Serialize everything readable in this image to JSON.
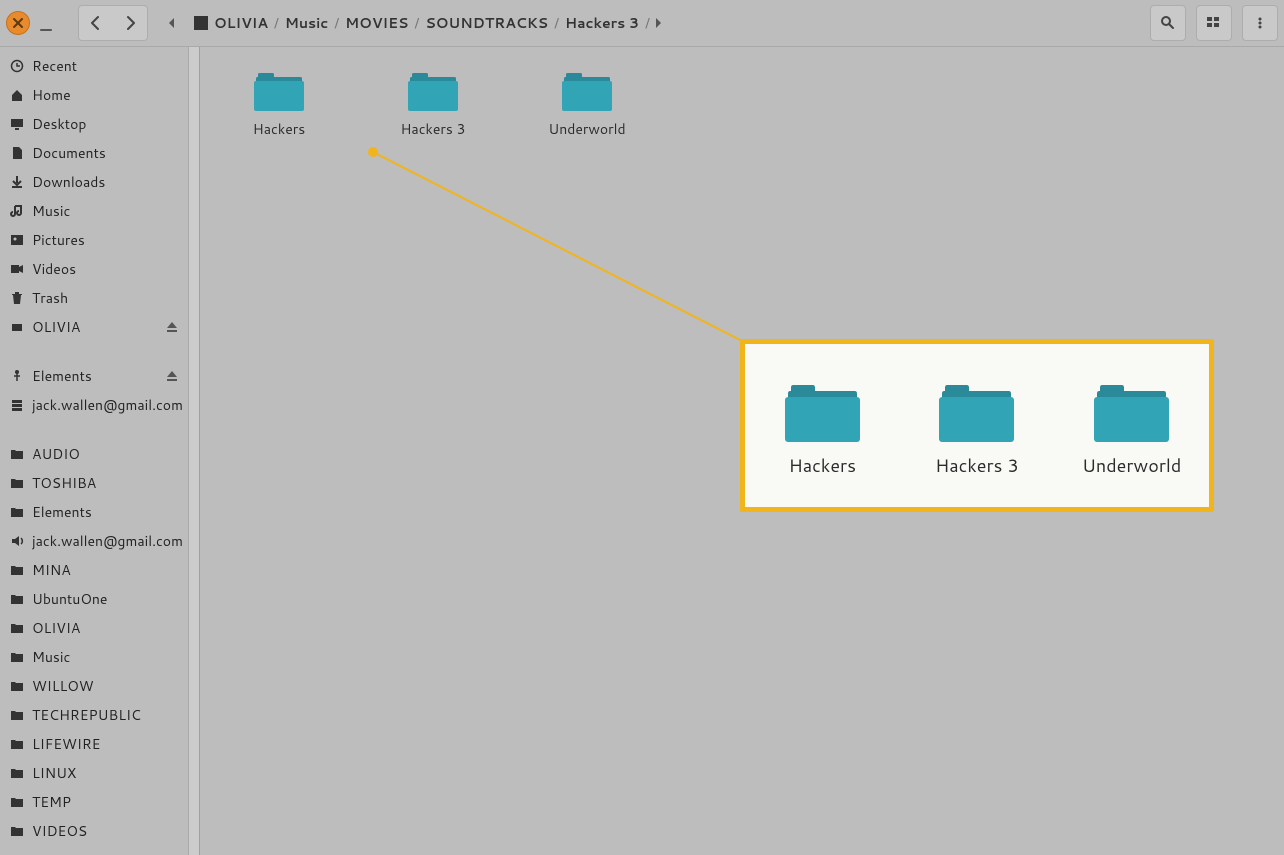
{
  "breadcrumb": [
    {
      "label": "OLIVIA",
      "drive": true
    },
    {
      "label": "Music"
    },
    {
      "label": "MOVIES"
    },
    {
      "label": "SOUNDTRACKS",
      "current": true
    },
    {
      "label": "Hackers 3"
    }
  ],
  "sidebar": {
    "places": [
      {
        "icon": "clock",
        "label": "Recent"
      },
      {
        "icon": "home",
        "label": "Home"
      },
      {
        "icon": "desktop",
        "label": "Desktop"
      },
      {
        "icon": "doc",
        "label": "Documents"
      },
      {
        "icon": "download",
        "label": "Downloads"
      },
      {
        "icon": "music",
        "label": "Music"
      },
      {
        "icon": "pic",
        "label": "Pictures"
      },
      {
        "icon": "video",
        "label": "Videos"
      },
      {
        "icon": "trash",
        "label": "Trash"
      },
      {
        "icon": "drive",
        "label": "OLIVIA",
        "eject": true
      }
    ],
    "devices": [
      {
        "icon": "usb",
        "label": "Elements",
        "eject": true
      },
      {
        "icon": "server",
        "label": "jack.wallen@gmail.com"
      }
    ],
    "bookmarks": [
      {
        "icon": "folder",
        "label": "AUDIO"
      },
      {
        "icon": "folder",
        "label": "TOSHIBA"
      },
      {
        "icon": "folder",
        "label": "Elements"
      },
      {
        "icon": "speaker",
        "label": "jack.wallen@gmail.com"
      },
      {
        "icon": "folder",
        "label": "MINA"
      },
      {
        "icon": "folder",
        "label": "UbuntuOne"
      },
      {
        "icon": "folder",
        "label": "OLIVIA"
      },
      {
        "icon": "folder",
        "label": "Music"
      },
      {
        "icon": "folder",
        "label": "WILLOW"
      },
      {
        "icon": "folder",
        "label": "TECHREPUBLIC"
      },
      {
        "icon": "folder",
        "label": "LIFEWIRE"
      },
      {
        "icon": "folder",
        "label": "LINUX"
      },
      {
        "icon": "folder",
        "label": "TEMP"
      },
      {
        "icon": "folder",
        "label": "VIDEOS"
      }
    ]
  },
  "folders": [
    {
      "label": "Hackers"
    },
    {
      "label": "Hackers 3"
    },
    {
      "label": "Underworld"
    }
  ],
  "callout_folders": [
    {
      "label": "Hackers"
    },
    {
      "label": "Hackers 3"
    },
    {
      "label": "Underworld"
    }
  ],
  "colors": {
    "accent": "#e98b2c",
    "folder": "#2f9fb0",
    "highlight": "#f2b41b"
  }
}
